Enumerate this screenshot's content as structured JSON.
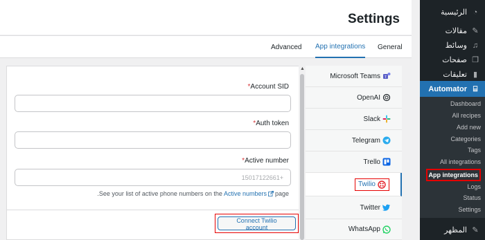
{
  "page": {
    "title": "Settings"
  },
  "tabs": [
    {
      "label": "General"
    },
    {
      "label": "App integrations"
    },
    {
      "label": "Advanced"
    }
  ],
  "sidebar": {
    "items": [
      {
        "label": "الرئيسية",
        "icon": "dashboard-icon"
      },
      {
        "label": "مقالات",
        "icon": "pin-icon"
      },
      {
        "label": "وسائط",
        "icon": "media-icon"
      },
      {
        "label": "صفحات",
        "icon": "pages-icon"
      },
      {
        "label": "تعليقات",
        "icon": "comments-icon"
      },
      {
        "label": "Automator",
        "icon": "automator-icon",
        "active": true
      },
      {
        "label": "المظهر",
        "icon": "appearance-icon"
      }
    ],
    "submenu": [
      {
        "label": "Dashboard"
      },
      {
        "label": "All recipes"
      },
      {
        "label": "Add new"
      },
      {
        "label": "Categories"
      },
      {
        "label": "Tags"
      },
      {
        "label": "All integrations"
      },
      {
        "label": "App integrations",
        "current": true
      },
      {
        "label": "Logs"
      },
      {
        "label": "Status"
      },
      {
        "label": "Settings"
      }
    ]
  },
  "integrations": [
    {
      "label": "Microsoft Teams",
      "icon": "teams-icon",
      "color": "#5b5fc7"
    },
    {
      "label": "OpenAI",
      "icon": "openai-icon",
      "color": "#1d2327"
    },
    {
      "label": "Slack",
      "icon": "slack-icon",
      "color": "#e01e5a"
    },
    {
      "label": "Telegram",
      "icon": "telegram-icon",
      "color": "#2aabee"
    },
    {
      "label": "Trello",
      "icon": "trello-icon",
      "color": "#0c66e4"
    },
    {
      "label": "Twilio",
      "icon": "twilio-icon",
      "color": "#e31e26",
      "selected": true
    },
    {
      "label": "Twitter",
      "icon": "twitter-icon",
      "color": "#1da1f2"
    },
    {
      "label": "WhatsApp",
      "icon": "whatsapp-icon",
      "color": "#25d366"
    }
  ],
  "form": {
    "account_sid": {
      "label": "Account SID",
      "value": ""
    },
    "auth_token": {
      "label": "Auth token",
      "value": ""
    },
    "active_number": {
      "label": "Active number",
      "placeholder": "15017122661+"
    },
    "help_text": ".See your list of active phone numbers on the",
    "help_link": "Active numbers",
    "help_suffix": "page",
    "connect_button": "Connect Twilio account"
  },
  "colors": {
    "accent": "#2271b1",
    "sidebar_bg": "#1d2327",
    "highlight_box": "#e60000"
  }
}
